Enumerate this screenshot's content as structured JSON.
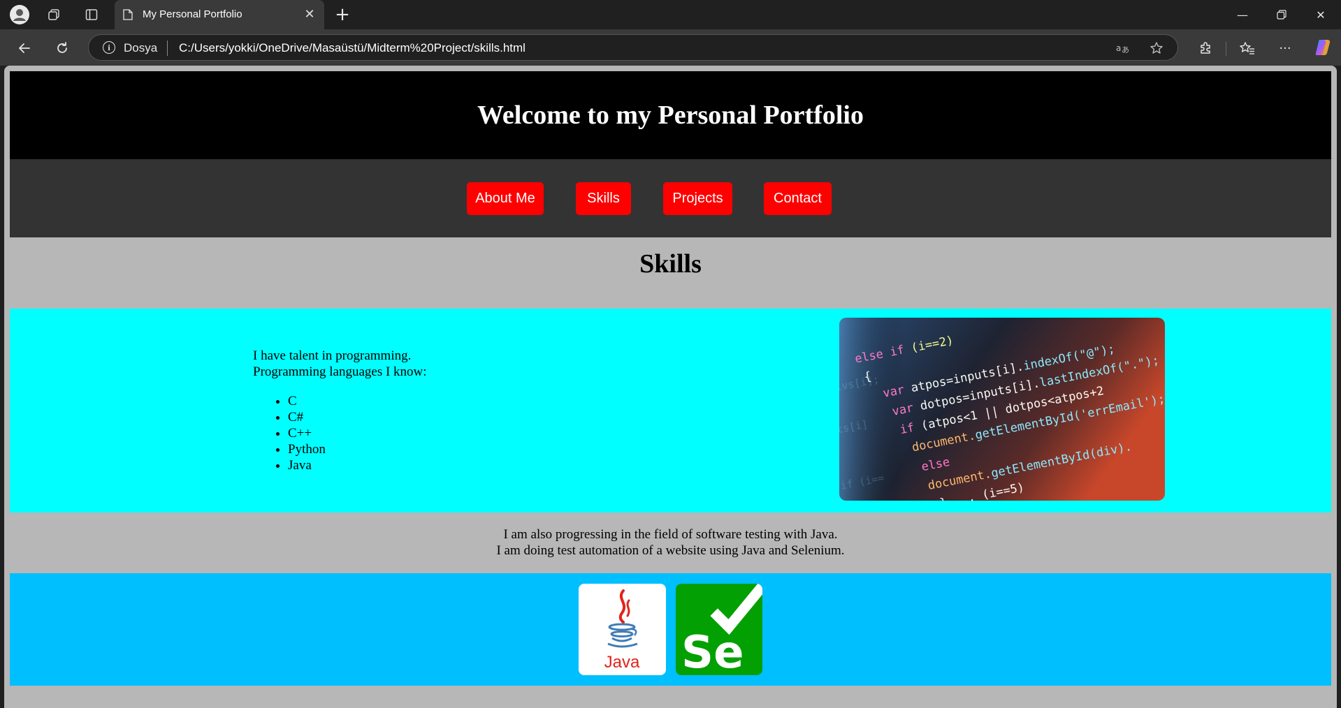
{
  "browser": {
    "tab_title": "My Personal Portfolio",
    "address_scheme": "Dosya",
    "url": "C:/Users/yokki/OneDrive/Masaüstü/Midterm%20Project/skills.html"
  },
  "header": {
    "title": "Welcome to my Personal Portfolio"
  },
  "nav": {
    "items": [
      {
        "label": "About Me"
      },
      {
        "label": "Skills"
      },
      {
        "label": "Projects"
      },
      {
        "label": "Contact"
      }
    ]
  },
  "skills": {
    "title": "Skills",
    "intro_line1": "I have talent in programming.",
    "intro_line2": "Programming languages I know:",
    "languages": [
      "C",
      "C#",
      "C++",
      "Python",
      "Java"
    ]
  },
  "testing": {
    "line1": "I am also progressing in the field of software testing with Java.",
    "line2": "I am doing test automation of a website using Java and Selenium."
  },
  "logos": {
    "java_text": "Java",
    "selenium_text": "Se"
  },
  "colors": {
    "nav_button": "#ff0000",
    "skills_panel": "#00ffff",
    "logos_panel": "#00bfff",
    "page_background": "#b7b7b7"
  }
}
